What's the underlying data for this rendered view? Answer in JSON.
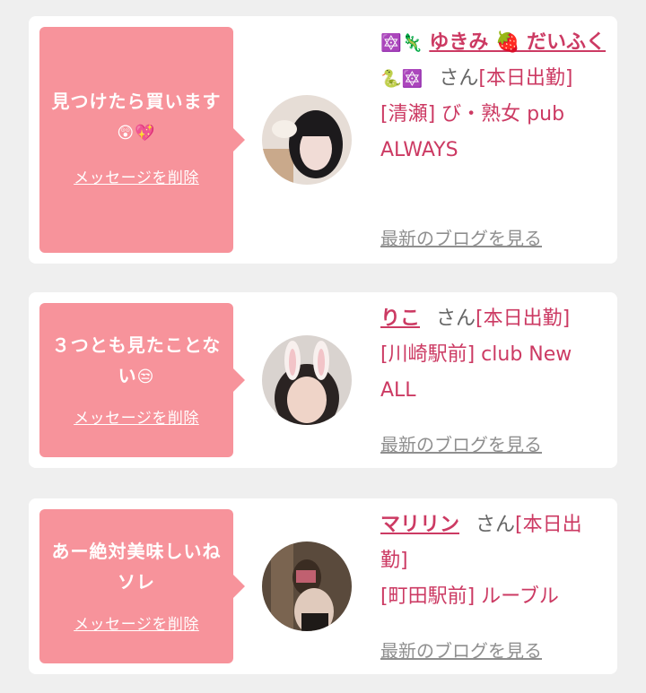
{
  "delete_label": "メッセージを削除",
  "blog_label": "最新のブログを見る",
  "san_label": "さん",
  "cards": [
    {
      "message": "見つけたら買います",
      "message_emoji": "😲💖",
      "name": "ゆきみ 🍓 だいふく",
      "name_prefix_emoji": "🔯🦎",
      "name_suffix_emoji": "🐍🔯",
      "status": "[本日出勤]",
      "area": "[清瀬]",
      "shop": "び・熟女 pub ALWAYS",
      "avatar_icon": "avatar-photo"
    },
    {
      "message": "３つとも見たことない",
      "message_emoji": "😒",
      "name": "りこ",
      "name_prefix_emoji": "",
      "name_suffix_emoji": "",
      "status": "[本日出勤]",
      "area": "[川崎駅前]",
      "shop": "club New ALL",
      "avatar_icon": "avatar-photo"
    },
    {
      "message": "あー絶対美味しいねソレ",
      "message_emoji": "",
      "name": "マリリン",
      "name_prefix_emoji": "",
      "name_suffix_emoji": "",
      "status": "[本日出勤]",
      "area": "[町田駅前]",
      "shop": "ルーブル",
      "avatar_icon": "avatar-photo"
    }
  ]
}
